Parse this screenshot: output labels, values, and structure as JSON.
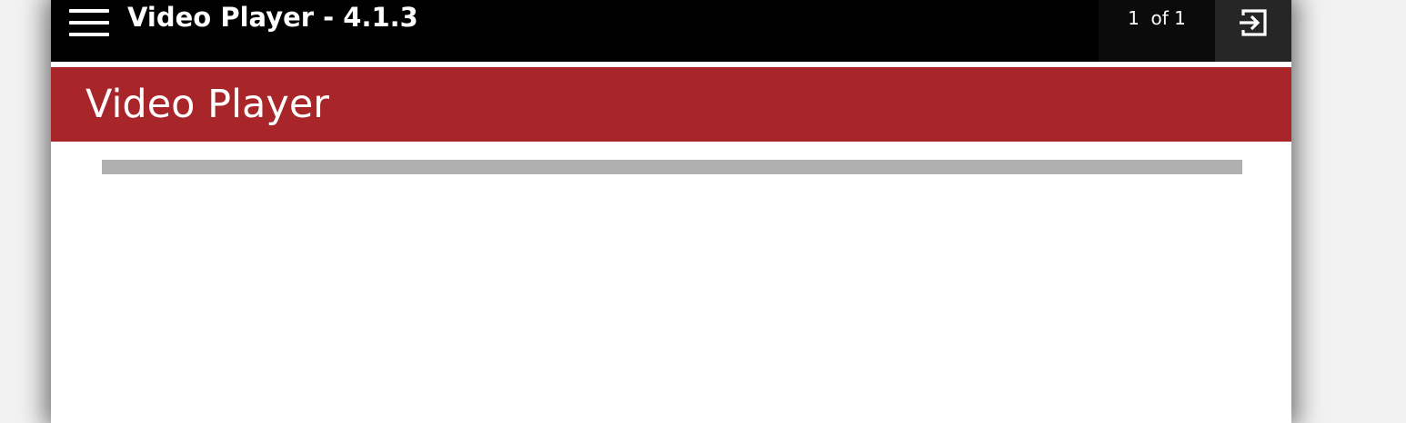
{
  "app": {
    "title": "Video Player - 4.1.3"
  },
  "pager": {
    "text": "1  of 1"
  },
  "icons": {
    "menu": "hamburger-menu-icon",
    "exit": "exit-icon"
  },
  "page": {
    "heading": "Video Player"
  },
  "progress": {
    "fraction": 0
  },
  "colors": {
    "topbar": "#000000",
    "banner": "#a8262a",
    "progress_track": "#b0b0b0",
    "exit_button": "#262626"
  }
}
